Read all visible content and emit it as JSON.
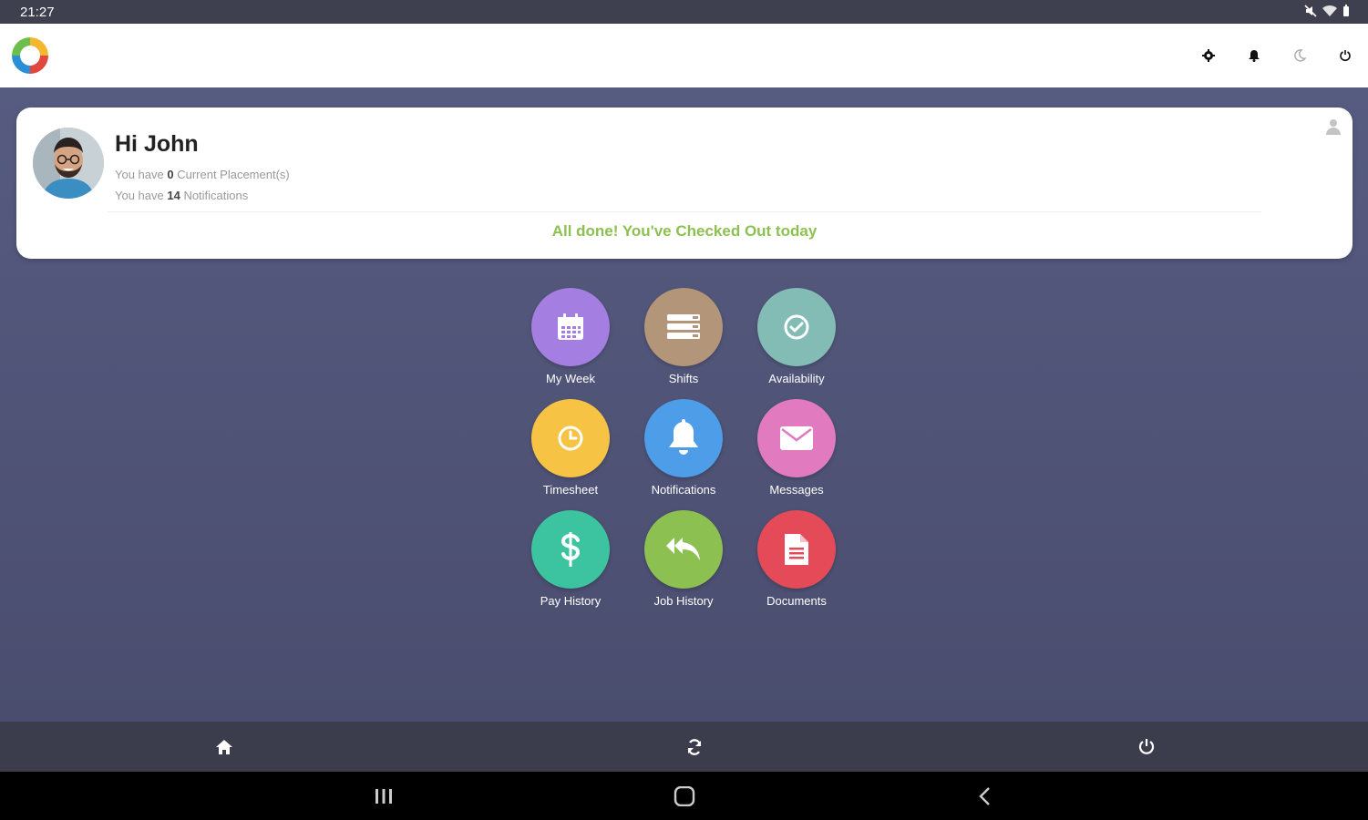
{
  "status_bar": {
    "time": "21:27",
    "icons": [
      "mute-icon",
      "wifi-icon",
      "battery-icon"
    ]
  },
  "top_bar": {
    "logo": "app-logo",
    "actions": [
      "settings-icon",
      "bell-icon",
      "moon-icon",
      "power-icon"
    ]
  },
  "card": {
    "greeting": "Hi John",
    "line1_prefix": "You have ",
    "placements_count": "0",
    "line1_suffix": " Current Placement(s)",
    "line2_prefix": "You have ",
    "notifications_count": "14",
    "line2_suffix": " Notifications",
    "checkout_message": "All done! You've Checked Out today"
  },
  "tiles": [
    {
      "label": "My Week",
      "color": "#a47ee0",
      "icon": "calendar-icon"
    },
    {
      "label": "Shifts",
      "color": "#b3957a",
      "icon": "list-icon"
    },
    {
      "label": "Availability",
      "color": "#83bcb5",
      "icon": "check-circle-icon"
    },
    {
      "label": "Timesheet",
      "color": "#f7c345",
      "icon": "clock-icon"
    },
    {
      "label": "Notifications",
      "color": "#4e9de8",
      "icon": "bell-icon"
    },
    {
      "label": "Messages",
      "color": "#e27ac0",
      "icon": "envelope-icon"
    },
    {
      "label": "Pay History",
      "color": "#3cc4a0",
      "icon": "dollar-icon"
    },
    {
      "label": "Job History",
      "color": "#8cc152",
      "icon": "reply-all-icon"
    },
    {
      "label": "Documents",
      "color": "#e44a57",
      "icon": "document-icon"
    }
  ],
  "colors": {
    "success": "#8cc152",
    "background": "#4f5275",
    "bottom_bar": "#3c3d4c"
  },
  "bottom_bar": [
    "home-icon",
    "refresh-icon",
    "power-icon"
  ],
  "nav_bar": [
    "recents-icon",
    "home-button-icon",
    "back-icon"
  ]
}
